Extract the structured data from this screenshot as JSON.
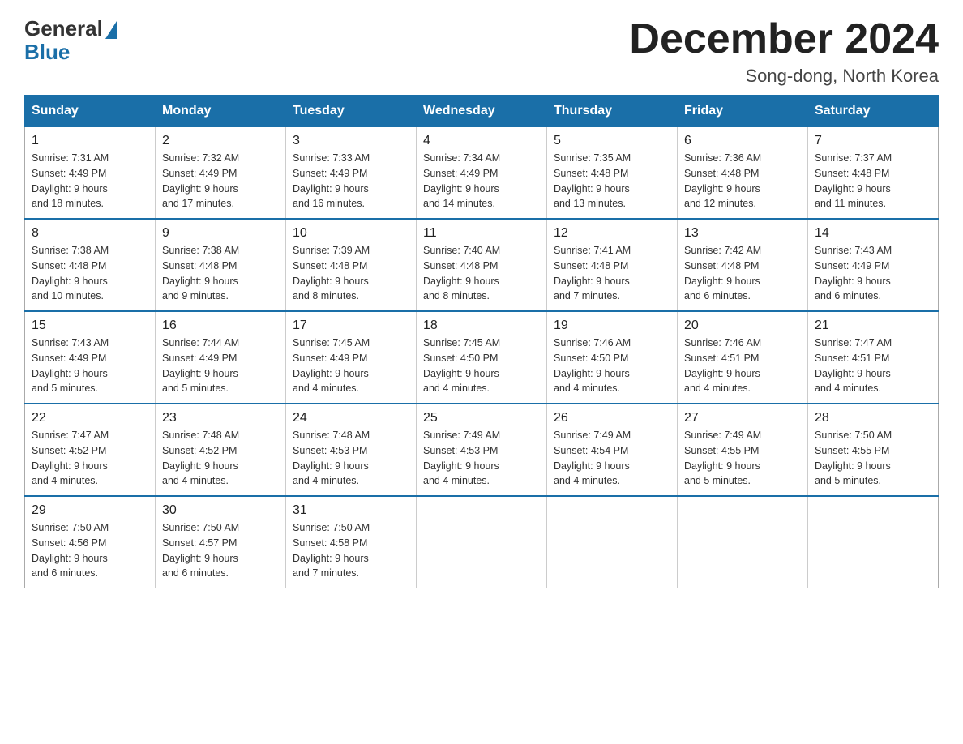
{
  "logo": {
    "general": "General",
    "blue": "Blue"
  },
  "title": "December 2024",
  "location": "Song-dong, North Korea",
  "days_of_week": [
    "Sunday",
    "Monday",
    "Tuesday",
    "Wednesday",
    "Thursday",
    "Friday",
    "Saturday"
  ],
  "weeks": [
    [
      {
        "day": "1",
        "sunrise": "7:31 AM",
        "sunset": "4:49 PM",
        "daylight": "9 hours and 18 minutes."
      },
      {
        "day": "2",
        "sunrise": "7:32 AM",
        "sunset": "4:49 PM",
        "daylight": "9 hours and 17 minutes."
      },
      {
        "day": "3",
        "sunrise": "7:33 AM",
        "sunset": "4:49 PM",
        "daylight": "9 hours and 16 minutes."
      },
      {
        "day": "4",
        "sunrise": "7:34 AM",
        "sunset": "4:49 PM",
        "daylight": "9 hours and 14 minutes."
      },
      {
        "day": "5",
        "sunrise": "7:35 AM",
        "sunset": "4:48 PM",
        "daylight": "9 hours and 13 minutes."
      },
      {
        "day": "6",
        "sunrise": "7:36 AM",
        "sunset": "4:48 PM",
        "daylight": "9 hours and 12 minutes."
      },
      {
        "day": "7",
        "sunrise": "7:37 AM",
        "sunset": "4:48 PM",
        "daylight": "9 hours and 11 minutes."
      }
    ],
    [
      {
        "day": "8",
        "sunrise": "7:38 AM",
        "sunset": "4:48 PM",
        "daylight": "9 hours and 10 minutes."
      },
      {
        "day": "9",
        "sunrise": "7:38 AM",
        "sunset": "4:48 PM",
        "daylight": "9 hours and 9 minutes."
      },
      {
        "day": "10",
        "sunrise": "7:39 AM",
        "sunset": "4:48 PM",
        "daylight": "9 hours and 8 minutes."
      },
      {
        "day": "11",
        "sunrise": "7:40 AM",
        "sunset": "4:48 PM",
        "daylight": "9 hours and 8 minutes."
      },
      {
        "day": "12",
        "sunrise": "7:41 AM",
        "sunset": "4:48 PM",
        "daylight": "9 hours and 7 minutes."
      },
      {
        "day": "13",
        "sunrise": "7:42 AM",
        "sunset": "4:48 PM",
        "daylight": "9 hours and 6 minutes."
      },
      {
        "day": "14",
        "sunrise": "7:43 AM",
        "sunset": "4:49 PM",
        "daylight": "9 hours and 6 minutes."
      }
    ],
    [
      {
        "day": "15",
        "sunrise": "7:43 AM",
        "sunset": "4:49 PM",
        "daylight": "9 hours and 5 minutes."
      },
      {
        "day": "16",
        "sunrise": "7:44 AM",
        "sunset": "4:49 PM",
        "daylight": "9 hours and 5 minutes."
      },
      {
        "day": "17",
        "sunrise": "7:45 AM",
        "sunset": "4:49 PM",
        "daylight": "9 hours and 4 minutes."
      },
      {
        "day": "18",
        "sunrise": "7:45 AM",
        "sunset": "4:50 PM",
        "daylight": "9 hours and 4 minutes."
      },
      {
        "day": "19",
        "sunrise": "7:46 AM",
        "sunset": "4:50 PM",
        "daylight": "9 hours and 4 minutes."
      },
      {
        "day": "20",
        "sunrise": "7:46 AM",
        "sunset": "4:51 PM",
        "daylight": "9 hours and 4 minutes."
      },
      {
        "day": "21",
        "sunrise": "7:47 AM",
        "sunset": "4:51 PM",
        "daylight": "9 hours and 4 minutes."
      }
    ],
    [
      {
        "day": "22",
        "sunrise": "7:47 AM",
        "sunset": "4:52 PM",
        "daylight": "9 hours and 4 minutes."
      },
      {
        "day": "23",
        "sunrise": "7:48 AM",
        "sunset": "4:52 PM",
        "daylight": "9 hours and 4 minutes."
      },
      {
        "day": "24",
        "sunrise": "7:48 AM",
        "sunset": "4:53 PM",
        "daylight": "9 hours and 4 minutes."
      },
      {
        "day": "25",
        "sunrise": "7:49 AM",
        "sunset": "4:53 PM",
        "daylight": "9 hours and 4 minutes."
      },
      {
        "day": "26",
        "sunrise": "7:49 AM",
        "sunset": "4:54 PM",
        "daylight": "9 hours and 4 minutes."
      },
      {
        "day": "27",
        "sunrise": "7:49 AM",
        "sunset": "4:55 PM",
        "daylight": "9 hours and 5 minutes."
      },
      {
        "day": "28",
        "sunrise": "7:50 AM",
        "sunset": "4:55 PM",
        "daylight": "9 hours and 5 minutes."
      }
    ],
    [
      {
        "day": "29",
        "sunrise": "7:50 AM",
        "sunset": "4:56 PM",
        "daylight": "9 hours and 6 minutes."
      },
      {
        "day": "30",
        "sunrise": "7:50 AM",
        "sunset": "4:57 PM",
        "daylight": "9 hours and 6 minutes."
      },
      {
        "day": "31",
        "sunrise": "7:50 AM",
        "sunset": "4:58 PM",
        "daylight": "9 hours and 7 minutes."
      },
      null,
      null,
      null,
      null
    ]
  ],
  "labels": {
    "sunrise": "Sunrise:",
    "sunset": "Sunset:",
    "daylight": "Daylight:"
  }
}
